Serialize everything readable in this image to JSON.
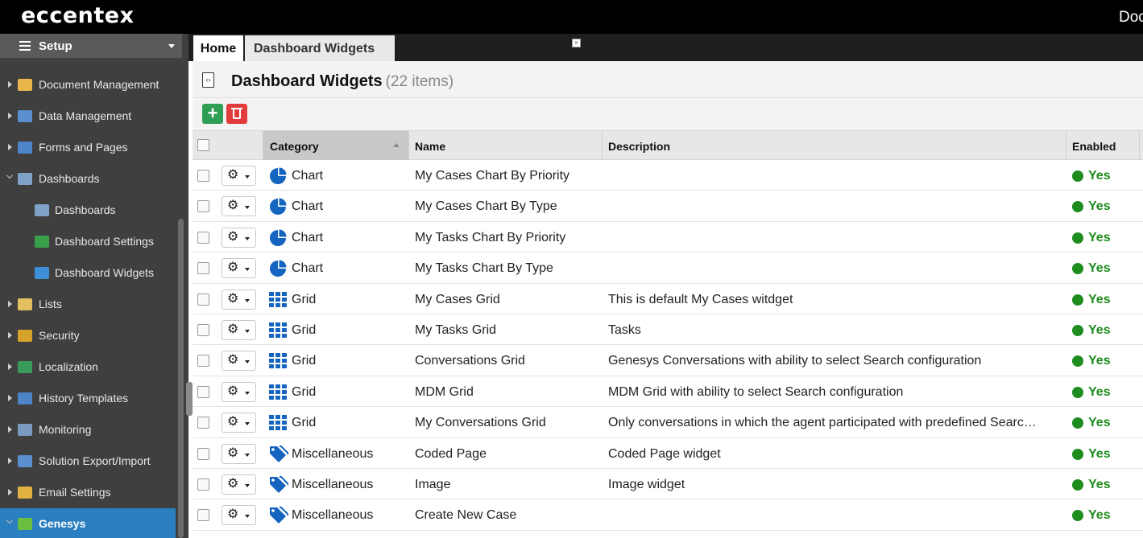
{
  "app": {
    "logo": "eccentex",
    "top_right": "Doc"
  },
  "sidebar": {
    "header": "Setup",
    "items": [
      {
        "label": "Document Management",
        "icon": "document-management-icon",
        "color": "#e8b64a",
        "level": 0,
        "state": "collapsed"
      },
      {
        "label": "Data Management",
        "icon": "data-management-icon",
        "color": "#5a8fd0",
        "level": 0,
        "state": "collapsed"
      },
      {
        "label": "Forms and Pages",
        "icon": "forms-icon",
        "color": "#4e85c9",
        "level": 0,
        "state": "collapsed"
      },
      {
        "label": "Dashboards",
        "icon": "dashboard-icon",
        "color": "#7fa3c8",
        "level": 0,
        "state": "expanded"
      },
      {
        "label": "Dashboards",
        "icon": "dashboard-icon",
        "color": "#7fa3c8",
        "level": 1,
        "state": ""
      },
      {
        "label": "Dashboard Settings",
        "icon": "settings-tree-icon",
        "color": "#3aa04a",
        "level": 1,
        "state": ""
      },
      {
        "label": "Dashboard Widgets",
        "icon": "code-icon",
        "color": "#3d8fd8",
        "level": 1,
        "state": ""
      },
      {
        "label": "Lists",
        "icon": "list-icon",
        "color": "#e0c060",
        "level": 0,
        "state": "collapsed"
      },
      {
        "label": "Security",
        "icon": "lock-icon",
        "color": "#d6a22a",
        "level": 0,
        "state": "collapsed"
      },
      {
        "label": "Localization",
        "icon": "globe-icon",
        "color": "#3a9a5a",
        "level": 0,
        "state": "collapsed"
      },
      {
        "label": "History Templates",
        "icon": "history-icon",
        "color": "#4e85c9",
        "level": 0,
        "state": "collapsed"
      },
      {
        "label": "Monitoring",
        "icon": "monitor-icon",
        "color": "#7a9ac0",
        "level": 0,
        "state": "collapsed"
      },
      {
        "label": "Solution Export/Import",
        "icon": "export-import-icon",
        "color": "#5a8fd0",
        "level": 0,
        "state": "collapsed"
      },
      {
        "label": "Email Settings",
        "icon": "email-icon",
        "color": "#e0b040",
        "level": 0,
        "state": "collapsed"
      },
      {
        "label": "Genesys",
        "icon": "puzzle-icon",
        "color": "#6abf40",
        "level": 0,
        "state": "expanded-active"
      }
    ]
  },
  "tabs": [
    {
      "label": "Home"
    },
    {
      "label": "Dashboard Widgets",
      "close": "×"
    }
  ],
  "page": {
    "title": "Dashboard Widgets",
    "count": "(22 items)"
  },
  "toolbar": {
    "add": "+",
    "accent_add": "#2f9e55",
    "accent_delete": "#e23b3b"
  },
  "grid": {
    "columns": [
      "Category",
      "Name",
      "Description",
      "Enabled"
    ],
    "sorted_column": "Category",
    "rows": [
      {
        "category": "Chart",
        "name": "My Cases Chart By Priority",
        "description": "",
        "enabled": "Yes"
      },
      {
        "category": "Chart",
        "name": "My Cases Chart By Type",
        "description": "",
        "enabled": "Yes"
      },
      {
        "category": "Chart",
        "name": "My Tasks Chart By Priority",
        "description": "",
        "enabled": "Yes"
      },
      {
        "category": "Chart",
        "name": "My Tasks Chart By Type",
        "description": "",
        "enabled": "Yes"
      },
      {
        "category": "Grid",
        "name": "My Cases Grid",
        "description": "This is default My Cases witdget",
        "enabled": "Yes"
      },
      {
        "category": "Grid",
        "name": "My Tasks Grid",
        "description": "Tasks",
        "enabled": "Yes"
      },
      {
        "category": "Grid",
        "name": "Conversations Grid",
        "description": "Genesys Conversations with ability to select Search configuration",
        "enabled": "Yes"
      },
      {
        "category": "Grid",
        "name": "MDM Grid",
        "description": "MDM Grid with ability to select Search configuration",
        "enabled": "Yes"
      },
      {
        "category": "Grid",
        "name": "My Conversations Grid",
        "description": "Only conversations in which the agent participated with predefined Searc…",
        "enabled": "Yes"
      },
      {
        "category": "Miscellaneous",
        "name": "Coded Page",
        "description": "Coded Page widget",
        "enabled": "Yes"
      },
      {
        "category": "Miscellaneous",
        "name": "Image",
        "description": "Image widget",
        "enabled": "Yes"
      },
      {
        "category": "Miscellaneous",
        "name": "Create New Case",
        "description": "",
        "enabled": "Yes"
      }
    ],
    "category_icons": {
      "Chart": "pie-chart-icon",
      "Grid": "grid-icon",
      "Miscellaneous": "tags-icon"
    },
    "accent": "#1565c0",
    "enabled_color": "#1e8c1e"
  }
}
